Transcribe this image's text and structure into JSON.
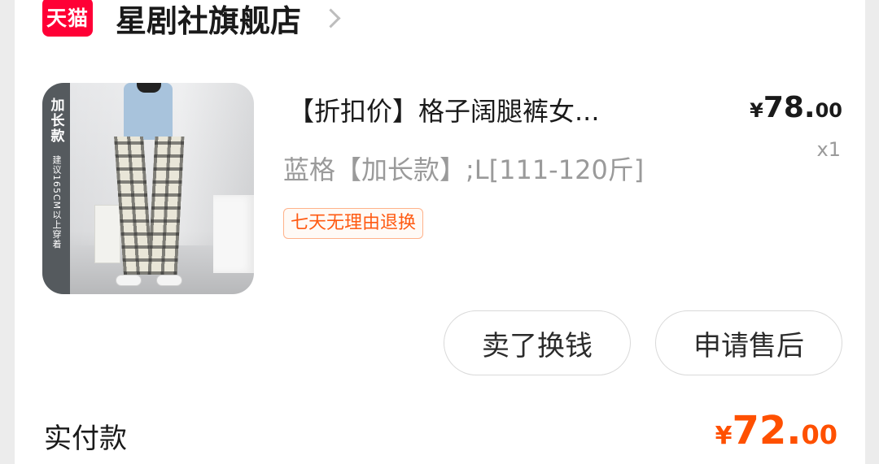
{
  "shop": {
    "logo_text": "天猫",
    "name": "星剧社旗舰店",
    "chevron_icon": "chevron-right-icon",
    "brand_color": "#ff0036"
  },
  "product": {
    "image": {
      "banner_big": "加长款",
      "banner_small": "建议165CM以上穿着"
    },
    "title": "【折扣价】格子阔腿裤女...",
    "sku": "蓝格【加长款】;L[111-120斤]",
    "tag": "七天无理由退换",
    "price": {
      "yen": "¥",
      "integer": "78.",
      "decimal": "00"
    },
    "quantity": "x1"
  },
  "actions": {
    "sell_label": "卖了换钱",
    "aftersale_label": "申请售后"
  },
  "payment": {
    "label": "实付款",
    "yen": "¥",
    "integer": "72.",
    "decimal": "00",
    "accent_color": "#ff5000"
  }
}
